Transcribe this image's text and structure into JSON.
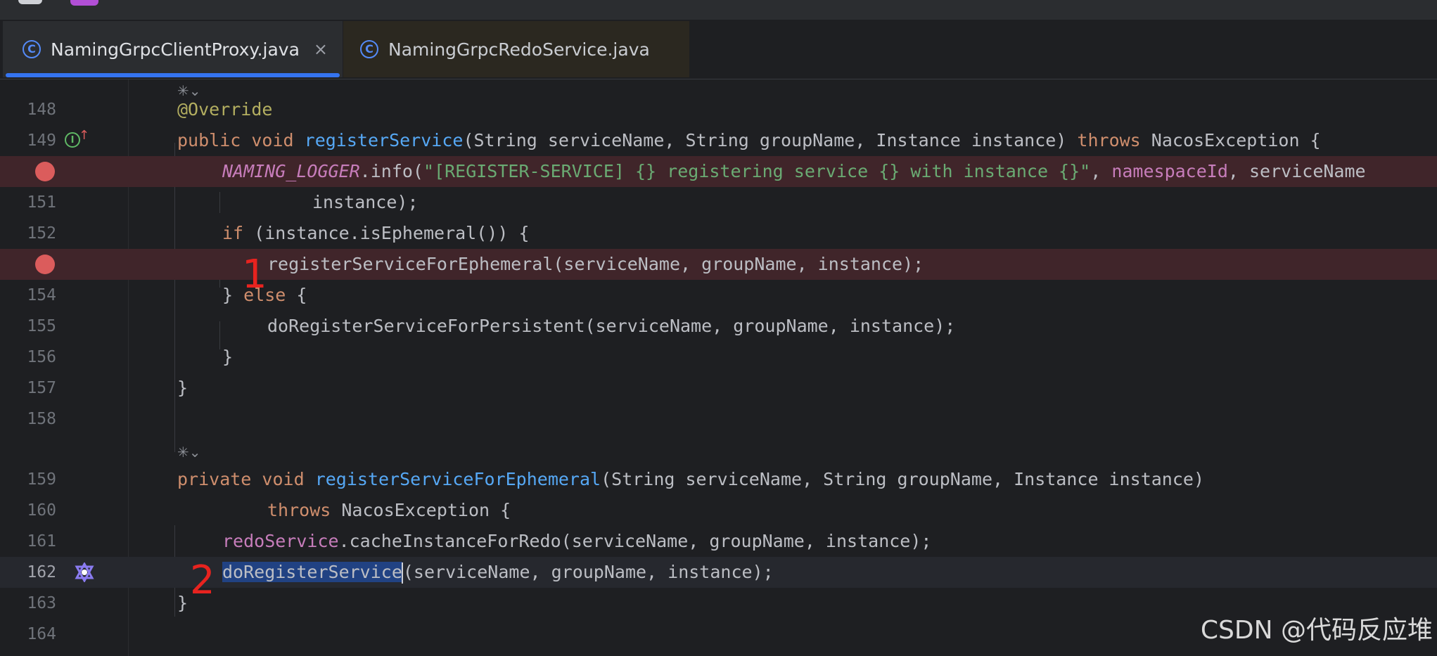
{
  "tabs": [
    {
      "label": "NamingGrpcClientProxy.java",
      "icon": "class-icon",
      "icon_glyph": "C",
      "close_glyph": "×",
      "active": true
    },
    {
      "label": "NamingGrpcRedoService.java",
      "icon": "class-icon",
      "icon_glyph": "C",
      "active": false
    }
  ],
  "editor": {
    "line_numbers": {
      "l148": "148",
      "l149": "149",
      "l151": "151",
      "l152": "152",
      "l154": "154",
      "l155": "155",
      "l156": "156",
      "l157": "157",
      "l158": "158",
      "l159": "159",
      "l160": "160",
      "l161": "161",
      "l162": "162",
      "l163": "163",
      "l164": "164"
    },
    "tokens": {
      "override": "@Override",
      "public_kw": "public",
      "void_kw": "void",
      "register_service_fn": "registerService",
      "register_service_params": "(String serviceName, String groupName, Instance instance) ",
      "throws_kw": "throws",
      "nacos_exception_open": " NacosException {",
      "naming_logger": "NAMING_LOGGER",
      "info_call": ".info(",
      "log_string": "\"[REGISTER-SERVICE] {} registering service {} with instance {}\"",
      "comma_sep": ", ",
      "namespace_id": "namespaceId",
      "service_name_trail": ", serviceName",
      "instance_close": "instance);",
      "if_kw": "if",
      "if_condition": " (instance.isEphemeral()) {",
      "call_register_ephemeral": "registerServiceForEphemeral(serviceName, groupName, instance);",
      "else_open_brace": "} ",
      "else_kw": "else",
      "else_close": " {",
      "call_do_register_persistent": "doRegisterServiceForPersistent(serviceName, groupName, instance);",
      "close_brace": "}",
      "private_kw": "private",
      "register_ephemeral_fn": "registerServiceForEphemeral",
      "register_ephemeral_params": "(String serviceName, String groupName, Instance instance)",
      "nacos_exception_brace": " NacosException {",
      "redo_service": "redoService",
      "cache_call": ".cacheInstanceForRedo(serviceName, groupName, instance);",
      "do_register_service": "doRegisterService",
      "do_register_args": "(serviceName, groupName, instance);"
    },
    "fold_hint": "✳⌄",
    "breakpoint_lines": [
      "150",
      "153"
    ],
    "current_line": "162"
  },
  "annotations": {
    "marker_1": "1",
    "marker_2": "2"
  },
  "watermark": "CSDN @代码反应堆",
  "colors": {
    "keyword": "#cf8e6d",
    "annotation": "#b3ae60",
    "method_decl": "#56a8f5",
    "string": "#6aab73",
    "field": "#c77dbb",
    "breakpoint": "#db5c5c",
    "marker_red": "#e8231f",
    "selection": "#214283"
  }
}
